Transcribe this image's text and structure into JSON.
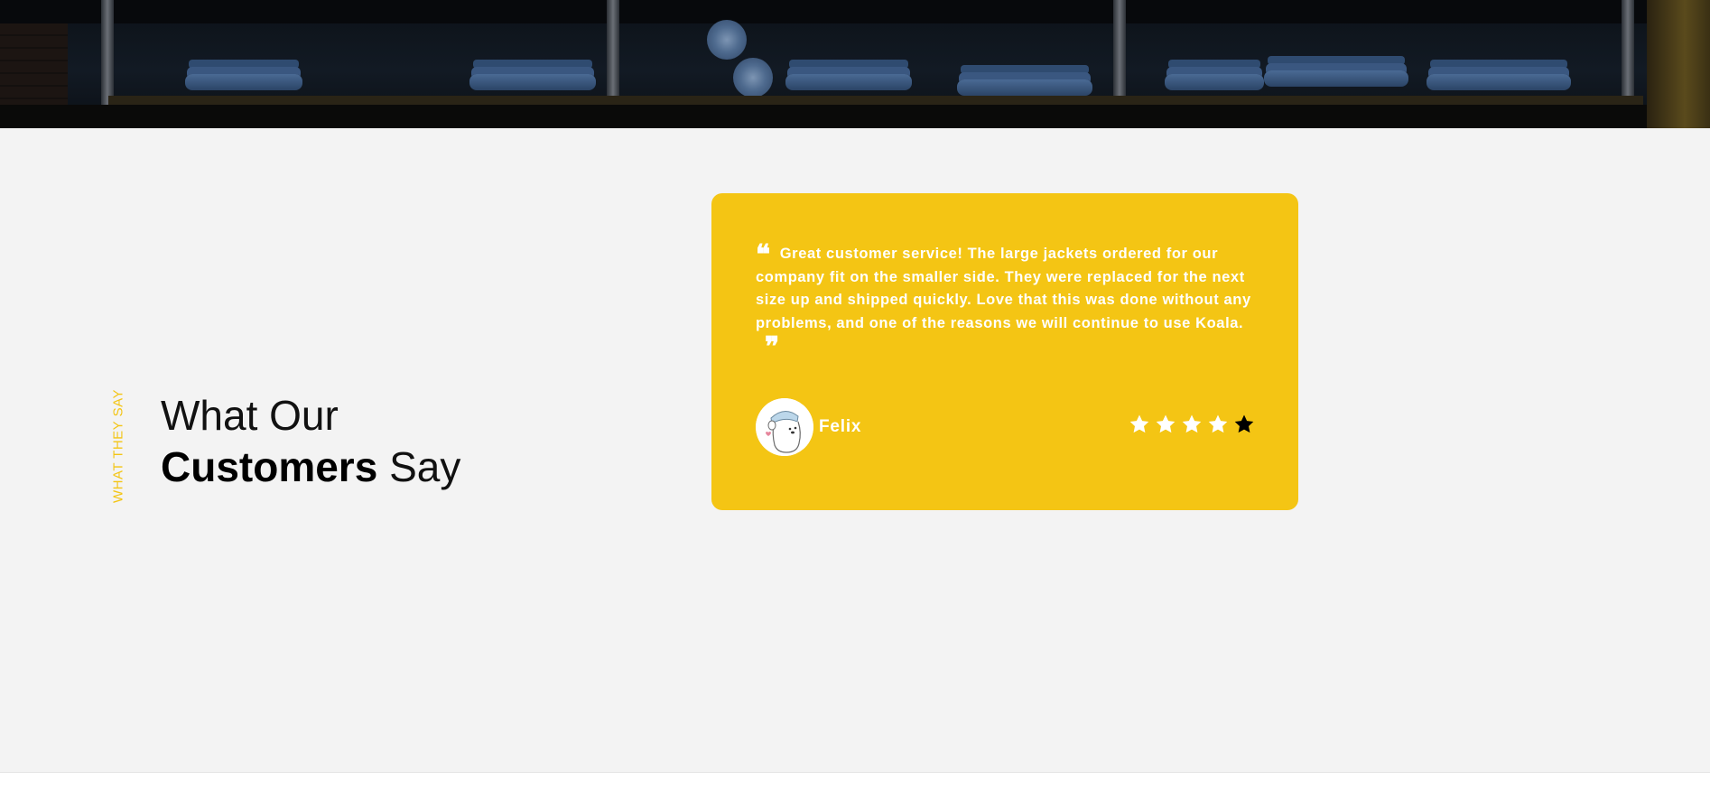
{
  "hero": {
    "image_icon": "jeans-shelf-photo"
  },
  "section": {
    "eyebrow": "WHAT THEY SAY",
    "heading_line1": "What Our",
    "heading_bold": "Customers",
    "heading_tail": " Say"
  },
  "testimonial": {
    "open_quote": "❝",
    "close_quote": "❞",
    "text": "Great customer service! The large jackets ordered for our company fit on the smaller side. They were replaced for the next size up and shipped quickly. Love that this was done without any problems, and one of the reasons we will continue to use Koala.",
    "author": "Felix",
    "avatar_icon": "koala-avatar-icon",
    "rating": {
      "stars_total": 5,
      "stars_white": 4,
      "stars_black": 1
    }
  },
  "colors": {
    "accent_yellow": "#f4c514",
    "section_bg": "#f3f3f3",
    "heading_text": "#111111",
    "star_white": "#ffffff",
    "star_dark": "#000000"
  }
}
